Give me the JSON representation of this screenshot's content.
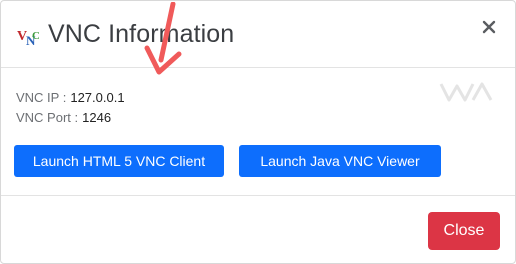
{
  "header": {
    "title": "VNC Information",
    "logo_icon": "vnc-logo-icon",
    "close_icon": "close-icon"
  },
  "body": {
    "ip_label": "VNC IP :",
    "ip_value": "127.0.0.1",
    "port_label": "VNC Port :",
    "port_value": "1246",
    "watermark_icon": "wa-logo-icon",
    "buttons": {
      "html5_label": "Launch HTML 5 VNC Client",
      "java_label": "Launch Java VNC Viewer"
    },
    "annotation_icon": "red-arrow-icon"
  },
  "footer": {
    "close_label": "Close"
  },
  "colors": {
    "primary": "#0d6efd",
    "danger": "#dc3545",
    "annotation": "#f05a5a"
  }
}
